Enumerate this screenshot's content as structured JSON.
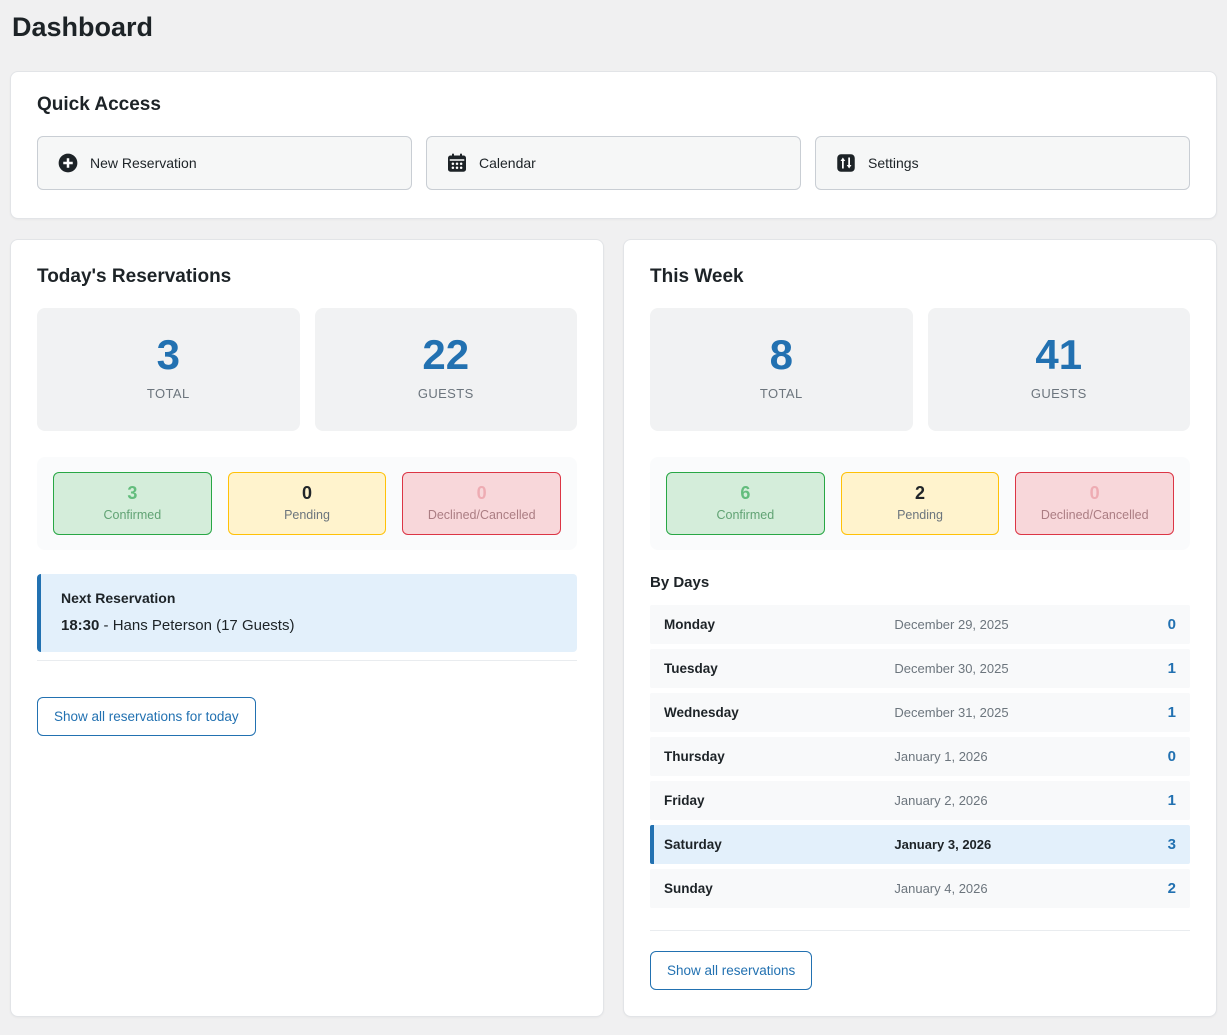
{
  "page": {
    "title": "Dashboard"
  },
  "colors": {
    "accent_blue": "#2271b1",
    "confirmed_green": "#28a745",
    "pending_yellow": "#ffc107",
    "declined_red": "#dc3545",
    "highlight_blue_bg": "#e3f0fb",
    "page_background": "#f0f0f1"
  },
  "quick_access": {
    "title": "Quick Access",
    "buttons": [
      {
        "label": "New Reservation",
        "icon": "plus-circle-icon"
      },
      {
        "label": "Calendar",
        "icon": "calendar-icon"
      },
      {
        "label": "Settings",
        "icon": "settings-icon"
      }
    ]
  },
  "today": {
    "title": "Today's Reservations",
    "stats": [
      {
        "value": "3",
        "label": "TOTAL"
      },
      {
        "value": "22",
        "label": "GUESTS"
      }
    ],
    "statuses": [
      {
        "value": "3",
        "label": "Confirmed"
      },
      {
        "value": "0",
        "label": "Pending"
      },
      {
        "value": "0",
        "label": "Declined/Cancelled"
      }
    ],
    "next_reservation": {
      "title": "Next Reservation",
      "time": "18:30",
      "details": " - Hans Peterson (17 Guests)"
    },
    "show_all_label": "Show all reservations for today"
  },
  "week": {
    "title": "This Week",
    "stats": [
      {
        "value": "8",
        "label": "TOTAL"
      },
      {
        "value": "41",
        "label": "GUESTS"
      }
    ],
    "statuses": [
      {
        "value": "6",
        "label": "Confirmed"
      },
      {
        "value": "2",
        "label": "Pending"
      },
      {
        "value": "0",
        "label": "Declined/Cancelled"
      }
    ],
    "by_days_title": "By Days",
    "days": [
      {
        "day": "Monday",
        "date": "December 29, 2025",
        "count": "0"
      },
      {
        "day": "Tuesday",
        "date": "December 30, 2025",
        "count": "1"
      },
      {
        "day": "Wednesday",
        "date": "December 31, 2025",
        "count": "1"
      },
      {
        "day": "Thursday",
        "date": "January 1, 2026",
        "count": "0"
      },
      {
        "day": "Friday",
        "date": "January 2, 2026",
        "count": "1"
      },
      {
        "day": "Saturday",
        "date": "January 3, 2026",
        "count": "3"
      },
      {
        "day": "Sunday",
        "date": "January 4, 2026",
        "count": "2"
      }
    ],
    "show_all_label": "Show all reservations"
  }
}
